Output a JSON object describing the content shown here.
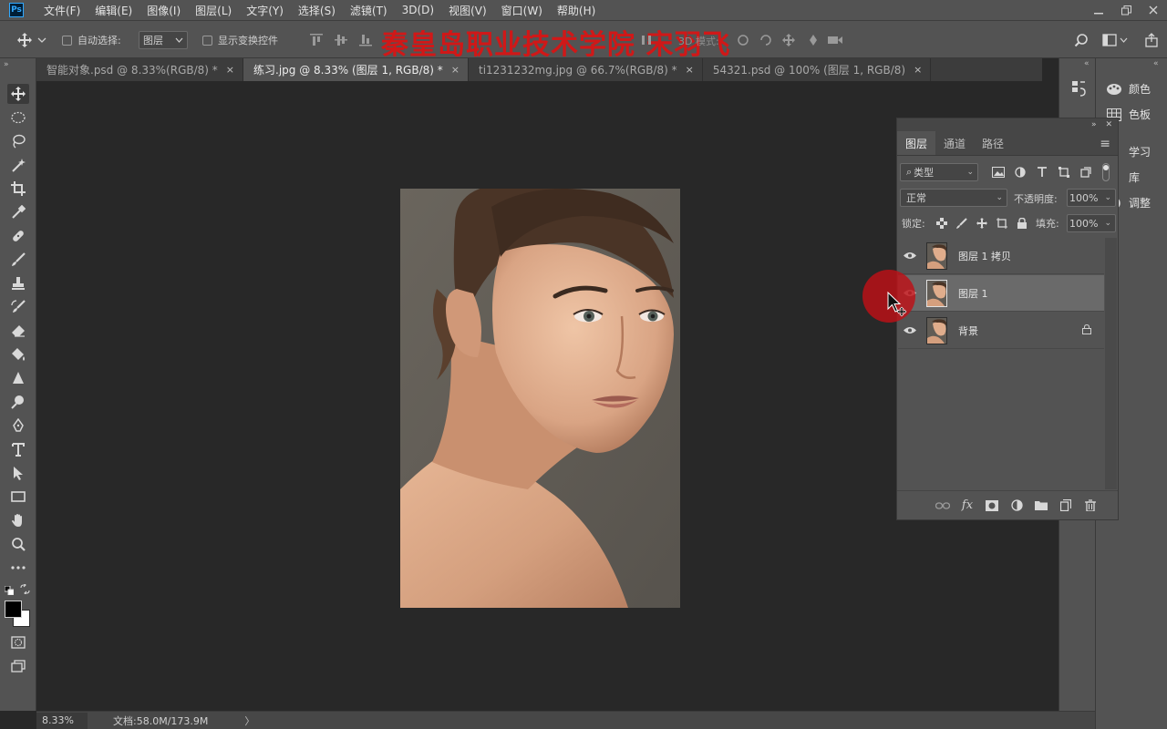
{
  "app": {
    "logo_text": "Ps"
  },
  "menu": [
    "文件(F)",
    "编辑(E)",
    "图像(I)",
    "图层(L)",
    "文字(Y)",
    "选择(S)",
    "滤镜(T)",
    "3D(D)",
    "视图(V)",
    "窗口(W)",
    "帮助(H)"
  ],
  "options_bar": {
    "auto_select_label": "自动选择:",
    "auto_select_target": "图层",
    "show_transform_label": "显示变换控件",
    "mode_3d_label": "3D 模式:"
  },
  "watermark": "秦皇岛职业技术学院 宋羽飞",
  "tabs": [
    {
      "label": "智能对象.psd @ 8.33%(RGB/8) *",
      "close": "×",
      "active": false
    },
    {
      "label": "练习.jpg @ 8.33% (图层 1, RGB/8) *",
      "close": "×",
      "active": true
    },
    {
      "label": "ti1231232mg.jpg @ 66.7%(RGB/8) *",
      "close": "×",
      "active": false
    },
    {
      "label": "54321.psd @ 100% (图层 1, RGB/8)",
      "close": "×",
      "active": false
    }
  ],
  "tools": [
    "move-tool",
    "marquee-tool",
    "lasso-tool",
    "magic-wand-tool",
    "crop-tool",
    "eyedropper-tool",
    "healing-brush-tool",
    "brush-tool",
    "clone-stamp-tool",
    "history-brush-tool",
    "eraser-tool",
    "paint-bucket-tool",
    "blur-tool",
    "dodge-tool",
    "pen-tool",
    "type-tool",
    "path-selection-tool",
    "rectangle-tool",
    "hand-tool",
    "zoom-tool",
    "more-tools"
  ],
  "side_panels": {
    "color": "颜色",
    "swatches": "色板",
    "learn": "学习",
    "library": "库",
    "adjustments": "调整"
  },
  "layers_panel": {
    "tabs": [
      "图层",
      "通道",
      "路径"
    ],
    "filter_kind": "类型",
    "blend_mode": "正常",
    "opacity_label": "不透明度:",
    "opacity_value": "100%",
    "lock_label": "锁定:",
    "fill_label": "填充:",
    "fill_value": "100%",
    "layers": [
      {
        "name": "图层 1 拷贝",
        "visible": true,
        "selected": false,
        "locked": false
      },
      {
        "name": "图层 1",
        "visible": true,
        "selected": true,
        "locked": false
      },
      {
        "name": "背景",
        "visible": true,
        "selected": false,
        "locked": true
      }
    ]
  },
  "status": {
    "zoom": "8.33%",
    "doc_size": "文档:58.0M/173.9M",
    "arrow": "〉"
  },
  "colors": {
    "cursor_highlight": "#be1016",
    "watermark": "#d01818"
  }
}
